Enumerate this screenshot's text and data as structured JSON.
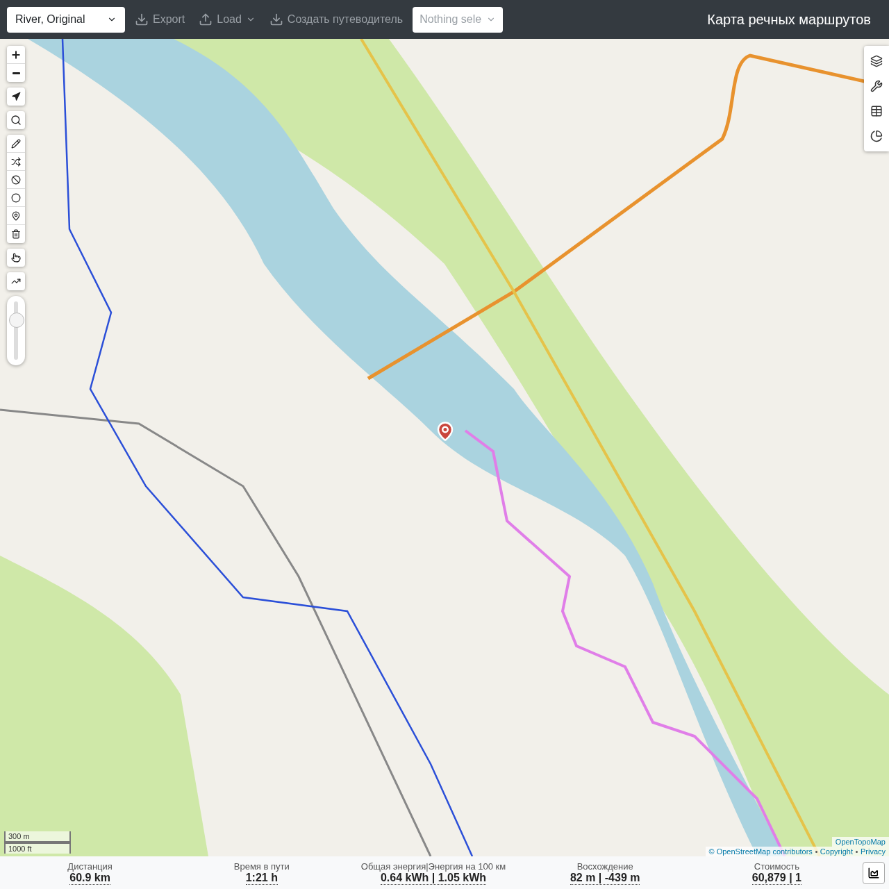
{
  "toolbar": {
    "profile_select": {
      "value": "River, Original"
    },
    "buttons": [
      {
        "label": "Export",
        "kind": "download"
      },
      {
        "label": "Load",
        "kind": "upload-menu"
      },
      {
        "label": "Создать путеводитель",
        "kind": "download"
      }
    ],
    "multiselect": {
      "placeholder": "Nothing sele"
    },
    "title": "Карта речных маршрутов"
  },
  "map": {
    "zoom_slider": {
      "level": 0.72
    },
    "scale": [
      "300 m",
      "1000 ft"
    ],
    "attribution": {
      "tiles": "OpenTopoMap",
      "links": [
        "© OpenStreetMap contributors",
        "Copyright",
        "Privacy"
      ]
    }
  },
  "stats": [
    {
      "label": "Дистанция",
      "value": "60.9 km"
    },
    {
      "label": "Время в пути",
      "value": "1:21 h"
    },
    {
      "label": "Общая энергия|Энергия на 100 км",
      "value": "0.64 kWh | 1.05 kWh"
    },
    {
      "label": "Восхождение",
      "value": "82 m | -439 m"
    },
    {
      "label": "Стоимость",
      "value": "60,879 | 1"
    }
  ]
}
